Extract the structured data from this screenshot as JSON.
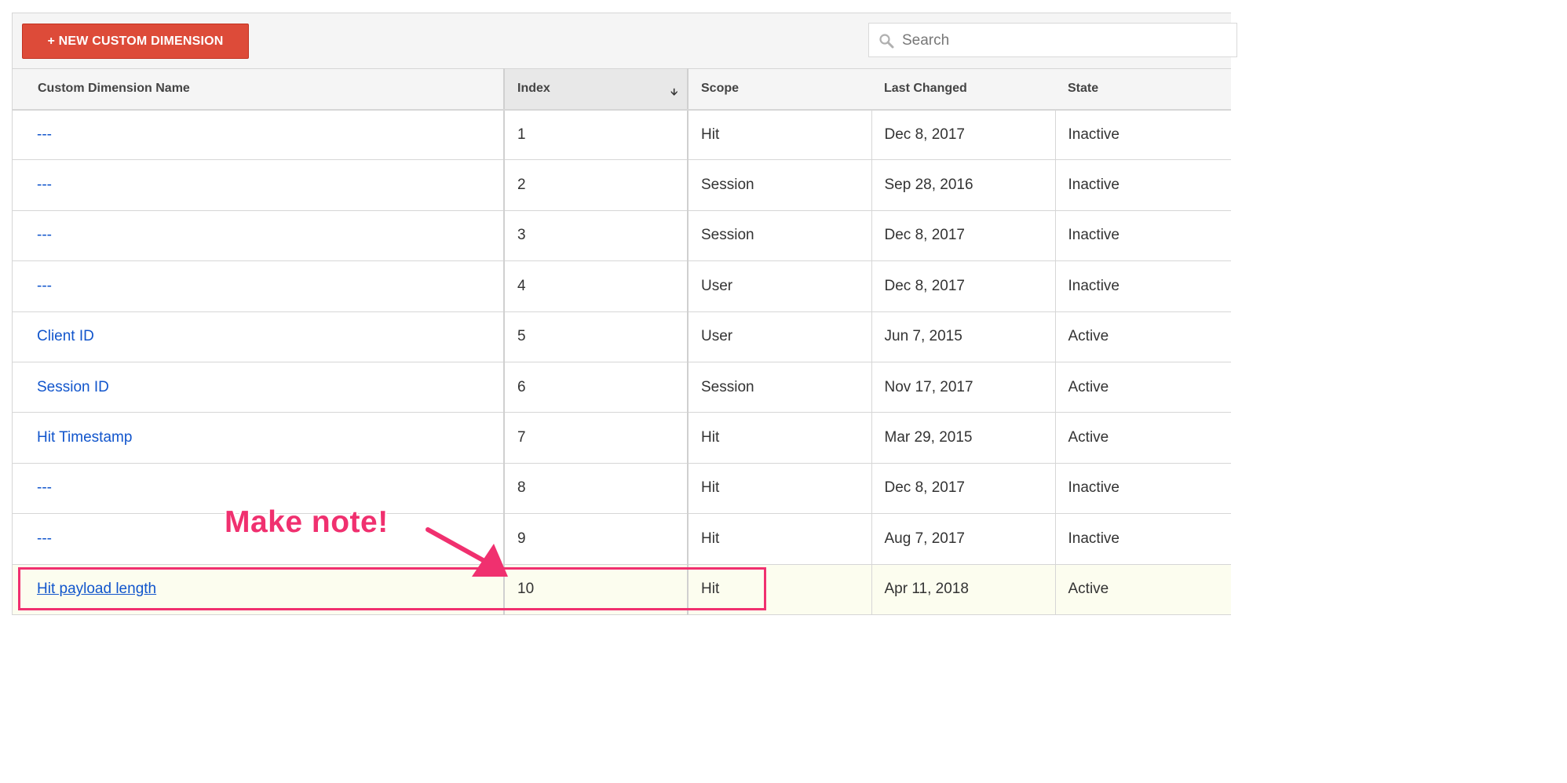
{
  "toolbar": {
    "new_button_label": "+ NEW CUSTOM DIMENSION",
    "search_placeholder": "Search"
  },
  "table": {
    "headers": [
      "Custom Dimension Name",
      "Index",
      "Scope",
      "Last Changed",
      "State"
    ],
    "sort_column": "Index",
    "rows": [
      {
        "name": "---",
        "index": "1",
        "scope": "Hit",
        "last_changed": "Dec 8, 2017",
        "state": "Inactive"
      },
      {
        "name": "---",
        "index": "2",
        "scope": "Session",
        "last_changed": "Sep 28, 2016",
        "state": "Inactive"
      },
      {
        "name": "---",
        "index": "3",
        "scope": "Session",
        "last_changed": "Dec 8, 2017",
        "state": "Inactive"
      },
      {
        "name": "---",
        "index": "4",
        "scope": "User",
        "last_changed": "Dec 8, 2017",
        "state": "Inactive"
      },
      {
        "name": "Client ID",
        "index": "5",
        "scope": "User",
        "last_changed": "Jun 7, 2015",
        "state": "Active"
      },
      {
        "name": "Session ID",
        "index": "6",
        "scope": "Session",
        "last_changed": "Nov 17, 2017",
        "state": "Active"
      },
      {
        "name": "Hit Timestamp",
        "index": "7",
        "scope": "Hit",
        "last_changed": "Mar 29, 2015",
        "state": "Active"
      },
      {
        "name": "---",
        "index": "8",
        "scope": "Hit",
        "last_changed": "Dec 8, 2017",
        "state": "Inactive"
      },
      {
        "name": "---",
        "index": "9",
        "scope": "Hit",
        "last_changed": "Aug 7, 2017",
        "state": "Inactive"
      },
      {
        "name": "Hit payload length",
        "index": "10",
        "scope": "Hit",
        "last_changed": "Apr 11, 2018",
        "state": "Active"
      }
    ]
  },
  "annotation": {
    "note_text": "Make note!",
    "color": "#f0306f"
  },
  "colors": {
    "button": "#dd4b39",
    "link": "#1155cc",
    "highlight_row": "#fcfdef"
  }
}
